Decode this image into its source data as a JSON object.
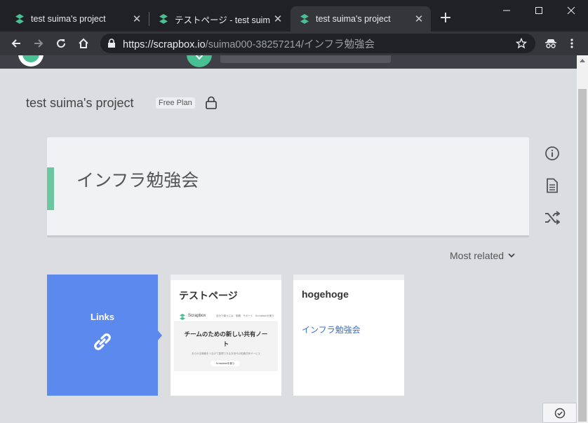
{
  "browser": {
    "tabs": [
      {
        "title": "test suima's project",
        "active": false
      },
      {
        "title": "テストページ - test suima's project",
        "active": false
      },
      {
        "title": "test suima's project",
        "active": true
      }
    ],
    "url_base": "https://scrapbox.io",
    "url_path": "/suima000-38257214/インフラ勉強会"
  },
  "project": {
    "title": "test suima's project",
    "plan": "Free Plan"
  },
  "page": {
    "title": "インフラ勉強会"
  },
  "related": {
    "sort_label": "Most related",
    "links_label": "Links",
    "cards": [
      {
        "title": "テストページ"
      },
      {
        "title": "hogehoge",
        "link": "インフラ勉強会"
      }
    ]
  },
  "thumbnail": {
    "brand": "Scrapbox",
    "nav": "自分で使うには　価格　サポート　Scrapboxを使う",
    "heading_line1": "チームのための新しい共有ノー",
    "heading_line2": "ト",
    "sub": "あらゆる情報をつなげて整理できる次世代の知識共有サービス",
    "button": "Scrapboxを使う"
  },
  "colors": {
    "accent_green": "#6cc7a0",
    "links_blue": "#5c89ee",
    "link_text": "#3b6dc8"
  }
}
